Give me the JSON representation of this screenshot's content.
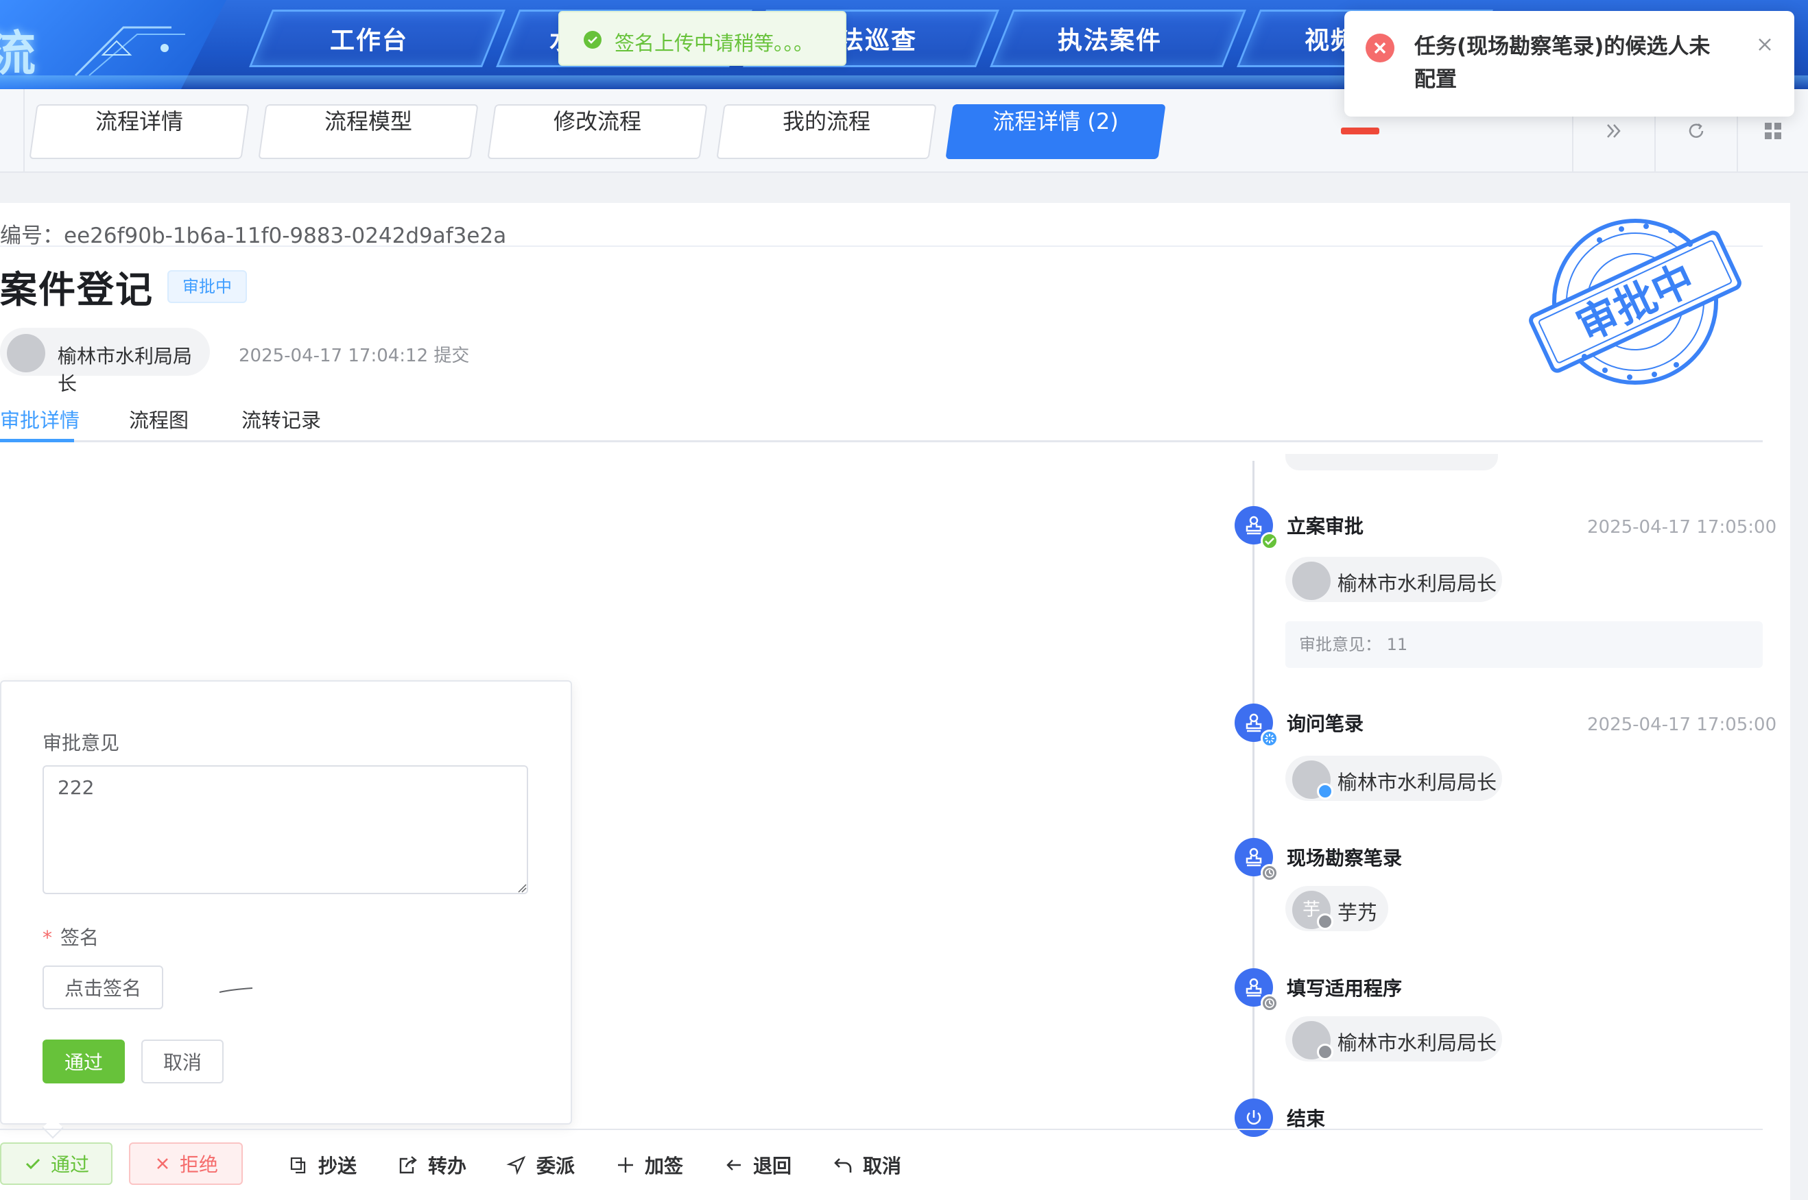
{
  "brand": {
    "title_char": "流"
  },
  "nav": {
    "items": [
      {
        "label": "工作台"
      },
      {
        "label": "水"
      },
      {
        "label": "法巡查"
      },
      {
        "label": "执法案件"
      },
      {
        "label": "视频"
      }
    ]
  },
  "tabs": {
    "items": [
      {
        "label": "流程详情"
      },
      {
        "label": "流程模型"
      },
      {
        "label": "修改流程"
      },
      {
        "label": "我的流程"
      },
      {
        "label": "流程详情 (2)",
        "active": true
      }
    ],
    "tools": [
      "double-chevron-right-icon",
      "refresh-icon",
      "grid-icon"
    ]
  },
  "detail": {
    "order_no": "编号：ee26f90b-1b6a-11f0-9883-0242d9af3e2a",
    "title": "案件登记",
    "status_tag": "审批中",
    "submitter": "榆林市水利局局长",
    "submit_time": "2025-04-17 17:04:12 提交",
    "tabs": [
      {
        "label": "审批详情",
        "active": true
      },
      {
        "label": "流程图"
      },
      {
        "label": "流转记录"
      }
    ],
    "stamp_text": "审批中"
  },
  "timeline": {
    "nodes": [
      {
        "title": "立案审批",
        "time": "2025-04-17 17:05:00",
        "user": "榆林市水利局局长",
        "comment": "审批意见：  11",
        "status": "approved"
      },
      {
        "title": "询问笔录",
        "time": "2025-04-17 17:05:00",
        "user": "榆林市水利局局长",
        "status": "processing"
      },
      {
        "title": "现场勘察笔录",
        "user": "芋艿",
        "avatar_text": "芋",
        "status": "pending"
      },
      {
        "title": "填写适用程序",
        "user": "榆林市水利局局长",
        "status": "pending"
      },
      {
        "title": "结束",
        "status": "end"
      }
    ]
  },
  "approval_form": {
    "opinion_label": "审批意见",
    "opinion_value": "222",
    "signature_label": "签名",
    "signature_required_mark": "*",
    "sign_button": "点击签名",
    "pass_button": "通过",
    "cancel_button": "取消"
  },
  "actions": {
    "pass": "通过",
    "reject": "拒绝",
    "copy": "抄送",
    "transfer": "转办",
    "delegate": "委派",
    "add_sign": "加签",
    "return": "退回",
    "cancel": "取消"
  },
  "toast": {
    "message": "签名上传中请稍等。。。"
  },
  "notification": {
    "message": "任务(现场勘察笔录)的候选人未配置"
  },
  "colors": {
    "primary": "#409eff",
    "success": "#67c23a",
    "danger": "#f56c6c",
    "nav_blue": "#1c56c8",
    "node_blue": "#3d6ff0",
    "active_tab": "#2f7cf6"
  }
}
